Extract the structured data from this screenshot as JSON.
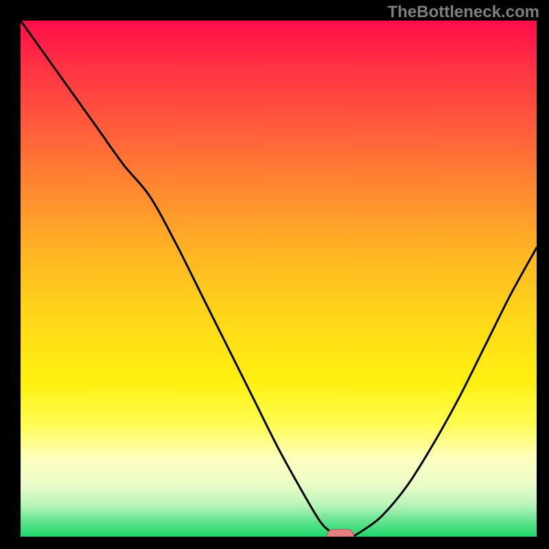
{
  "watermark_text": "TheBottleneck.com",
  "marker_color": "#e37f7f",
  "gradient_stops": [
    {
      "pos": 0,
      "color": "#ff0d4a"
    },
    {
      "pos": 8,
      "color": "#ff2e44"
    },
    {
      "pos": 20,
      "color": "#ff5a3d"
    },
    {
      "pos": 33,
      "color": "#ff8a30"
    },
    {
      "pos": 46,
      "color": "#ffb822"
    },
    {
      "pos": 58,
      "color": "#ffd819"
    },
    {
      "pos": 70,
      "color": "#fff010"
    },
    {
      "pos": 78,
      "color": "#fffc50"
    },
    {
      "pos": 85,
      "color": "#fdfec0"
    },
    {
      "pos": 90,
      "color": "#eafcc8"
    },
    {
      "pos": 94,
      "color": "#b6f4b8"
    },
    {
      "pos": 97,
      "color": "#63e38e"
    },
    {
      "pos": 100,
      "color": "#1dd86a"
    }
  ],
  "chart_data": {
    "type": "line",
    "title": "",
    "xlabel": "",
    "ylabel": "",
    "xlim": [
      0,
      100
    ],
    "ylim": [
      0,
      100
    ],
    "optimum_x": 62,
    "series": [
      {
        "name": "bottleneck-curve",
        "x": [
          0,
          5,
          10,
          15,
          20,
          25,
          30,
          35,
          40,
          45,
          50,
          55,
          58,
          60,
          62,
          64,
          66,
          70,
          75,
          80,
          85,
          90,
          95,
          100
        ],
        "y": [
          100,
          93,
          86,
          79,
          72,
          66,
          57,
          47,
          37,
          27,
          17,
          8,
          3,
          1,
          0,
          0,
          1,
          4,
          10,
          18,
          27,
          37,
          47,
          56
        ]
      }
    ],
    "annotations": [
      {
        "name": "optimal-marker",
        "x": 62,
        "y": 0
      }
    ]
  }
}
